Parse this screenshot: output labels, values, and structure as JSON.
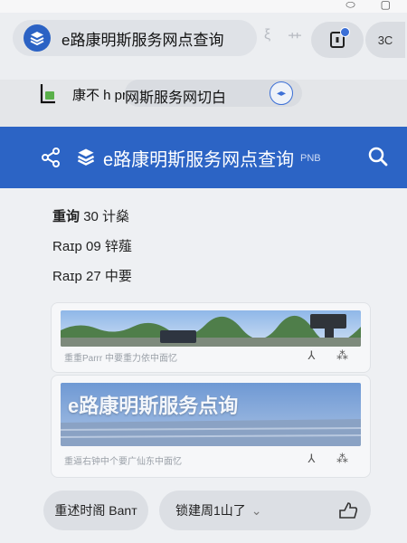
{
  "browser": {
    "tab_title": "e路康明斯服务网点查询",
    "faded_glyphs": [
      "ξ",
      "⺾"
    ],
    "counter": "3C"
  },
  "url_bar": {
    "prefix": "康不 h pr",
    "title": "网斯服务网切白"
  },
  "header": {
    "title": "e路康明斯服务网点查询",
    "subtitle": "PNB",
    "color": "#2c64c5"
  },
  "info": [
    {
      "label": "重询",
      "value": "30 计燊"
    },
    {
      "label": "Raɪp",
      "value": "09 锌薤"
    },
    {
      "label": "Raɪp",
      "value": "27 中要"
    }
  ],
  "cards": [
    {
      "caption": "重重Parrr 中要重力依中面忆",
      "icons": "⅄ ⁂"
    },
    {
      "banner": "e路康明斯服务点询",
      "caption": "重逼右钟中个要广仙东中面忆",
      "icons": "⅄ ⁂"
    }
  ],
  "bottom": {
    "left_label": "重述时阁 Banт",
    "right_label": "锁建周1山了",
    "right_chevron": "⌄"
  }
}
